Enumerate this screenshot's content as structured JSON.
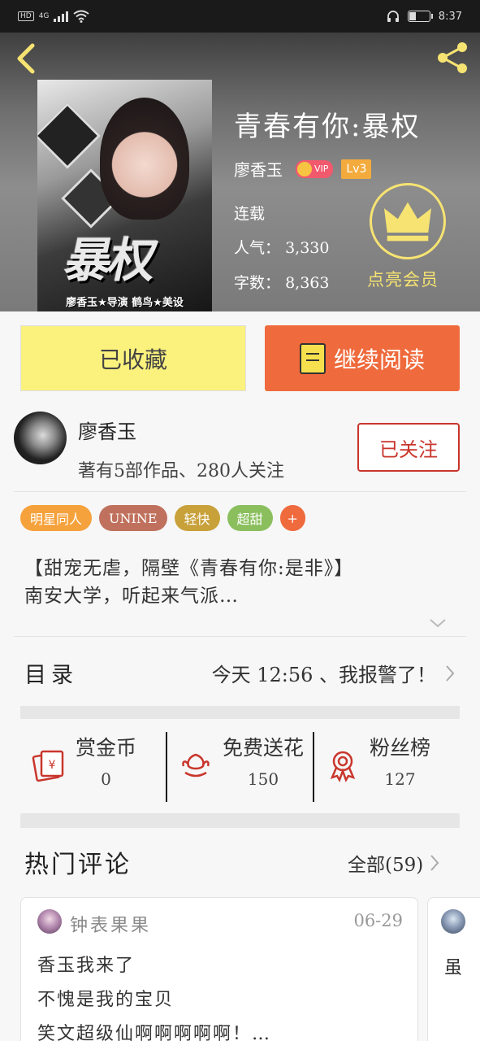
{
  "status_bar": {
    "network": "4G",
    "hd": "HD",
    "time": "8:37"
  },
  "book": {
    "title": "青春有你:暴权",
    "author": "廖香玉",
    "vip": "VIP",
    "level": "Lv3",
    "status": "连载",
    "popularity_label": "人气：",
    "popularity": "3,330",
    "words_label": "字数：",
    "words": "8,363",
    "cover_title": "暴权",
    "cover_credits": "廖香玉★导演 鹤鸟★美设"
  },
  "member": {
    "label": "点亮会员"
  },
  "buttons": {
    "collected": "已收藏",
    "continue_reading": "继续阅读",
    "follow": "已关注"
  },
  "author_card": {
    "name": "廖香玉",
    "stats": "著有5部作品、280人关注"
  },
  "tags": [
    {
      "label": "明星同人",
      "color": "#f6a23c"
    },
    {
      "label": "UNINE",
      "color": "#c0715d"
    },
    {
      "label": "轻快",
      "color": "#c8a13a"
    },
    {
      "label": "超甜",
      "color": "#8bbf5e"
    },
    {
      "label": "+",
      "color": "#ef6a3c"
    }
  ],
  "description": {
    "line1": "【甜宠无虐，隔壁《青春有你:是非》】",
    "line2": "南安大学，听起来气派…"
  },
  "toc": {
    "label": "目录",
    "latest": "今天 12:56 、我报警了！"
  },
  "actions": [
    {
      "label": "赏金币",
      "count": "0",
      "icon": "coin-envelope-icon"
    },
    {
      "label": "免费送花",
      "count": "150",
      "icon": "flower-icon"
    },
    {
      "label": "粉丝榜",
      "count": "127",
      "icon": "medal-icon"
    }
  ],
  "comments_section": {
    "title": "热门评论",
    "all": "全部(59)"
  },
  "comments": [
    {
      "user": "钟表果果",
      "date": "06-29",
      "line1": "香玉我来了",
      "line2": "不愧是我的宝贝",
      "line3": "笑文超级仙啊啊啊啊啊！…"
    },
    {
      "line1": "虽"
    }
  ],
  "colors": {
    "accent_orange": "#ef6a3c",
    "collected_yellow": "#fbf27e",
    "follow_red": "#c9362c",
    "member_gold": "#f6e372"
  }
}
